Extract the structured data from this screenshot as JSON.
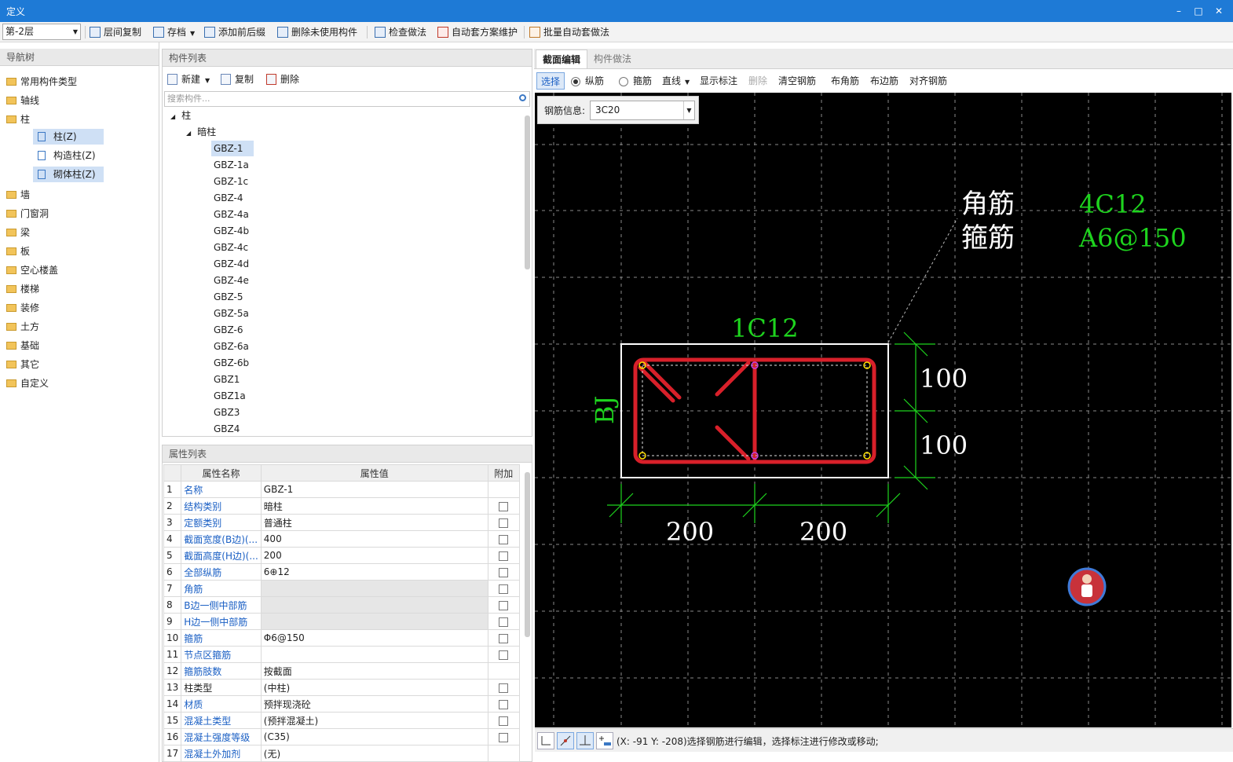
{
  "window": {
    "title": "定义"
  },
  "toolbar": {
    "floor": "第-2层",
    "buttons": [
      "层间复制",
      "存档",
      "添加前后缀",
      "删除未使用构件",
      "检查做法",
      "自动套方案维护",
      "批量自动套做法"
    ]
  },
  "nav": {
    "header": "导航树",
    "items": [
      "常用构件类型",
      "轴线",
      "柱",
      "墙",
      "门窗洞",
      "梁",
      "板",
      "空心楼盖",
      "楼梯",
      "装修",
      "土方",
      "基础",
      "其它",
      "自定义"
    ],
    "sub": [
      "柱(Z)",
      "构造柱(Z)",
      "砌体柱(Z)"
    ]
  },
  "complist": {
    "header": "构件列表",
    "tools": [
      "新建",
      "复制",
      "删除"
    ],
    "search_placeholder": "搜索构件...",
    "root": "柱",
    "group": "暗柱",
    "items": [
      "GBZ-1",
      "GBZ-1a",
      "GBZ-1c",
      "GBZ-4",
      "GBZ-4a",
      "GBZ-4b",
      "GBZ-4c",
      "GBZ-4d",
      "GBZ-4e",
      "GBZ-5",
      "GBZ-5a",
      "GBZ-6",
      "GBZ-6a",
      "GBZ-6b",
      "GBZ1",
      "GBZ1a",
      "GBZ3",
      "GBZ4"
    ]
  },
  "props": {
    "header": "属性列表",
    "columns": [
      "属性名称",
      "属性值",
      "附加"
    ],
    "rows": [
      {
        "n": "1",
        "k": "名称",
        "v": "GBZ-1",
        "chk": false,
        "gray": false,
        "link": true
      },
      {
        "n": "2",
        "k": "结构类别",
        "v": "暗柱",
        "chk": true,
        "gray": false,
        "link": true
      },
      {
        "n": "3",
        "k": "定额类别",
        "v": "普通柱",
        "chk": true,
        "gray": false,
        "link": true
      },
      {
        "n": "4",
        "k": "截面宽度(B边)(...",
        "v": "400",
        "chk": true,
        "gray": false,
        "link": true
      },
      {
        "n": "5",
        "k": "截面高度(H边)(...",
        "v": "200",
        "chk": true,
        "gray": false,
        "link": true
      },
      {
        "n": "6",
        "k": "全部纵筋",
        "v": "6⊕12",
        "chk": true,
        "gray": false,
        "link": true
      },
      {
        "n": "7",
        "k": "角筋",
        "v": "",
        "chk": true,
        "gray": true,
        "link": true
      },
      {
        "n": "8",
        "k": "B边一侧中部筋",
        "v": "",
        "chk": true,
        "gray": true,
        "link": true
      },
      {
        "n": "9",
        "k": "H边一侧中部筋",
        "v": "",
        "chk": true,
        "gray": true,
        "link": true
      },
      {
        "n": "10",
        "k": "箍筋",
        "v": "Φ6@150",
        "chk": true,
        "gray": false,
        "link": true
      },
      {
        "n": "11",
        "k": "节点区箍筋",
        "v": "",
        "chk": true,
        "gray": false,
        "link": true
      },
      {
        "n": "12",
        "k": "箍筋肢数",
        "v": "按截面",
        "chk": false,
        "gray": false,
        "link": true
      },
      {
        "n": "13",
        "k": "柱类型",
        "v": "(中柱)",
        "chk": true,
        "gray": false,
        "link": false
      },
      {
        "n": "14",
        "k": "材质",
        "v": "预拌现浇砼",
        "chk": true,
        "gray": false,
        "link": true
      },
      {
        "n": "15",
        "k": "混凝土类型",
        "v": "(预拌混凝土)",
        "chk": true,
        "gray": false,
        "link": true
      },
      {
        "n": "16",
        "k": "混凝土强度等级",
        "v": "(C35)",
        "chk": true,
        "gray": false,
        "link": true
      },
      {
        "n": "17",
        "k": "混凝土外加剂",
        "v": "(无)",
        "chk": false,
        "gray": false,
        "link": true
      }
    ]
  },
  "editor": {
    "tabs": [
      "截面编辑",
      "构件做法"
    ],
    "tools": {
      "select": "选择",
      "radio_long": "纵筋",
      "radio_stirrup": "箍筋",
      "line": "直线",
      "show_label": "显示标注",
      "delete": "删除",
      "clear": "清空钢筋",
      "corner": "布角筋",
      "edge": "布边筋",
      "align": "对齐钢筋"
    },
    "rebar_info_label": "钢筋信息:",
    "rebar_info_value": "3C20"
  },
  "drawing": {
    "corner_label": "角筋",
    "corner_value": "4C12",
    "stirrup_label": "箍筋",
    "stirrup_value": "A6@150",
    "mid_label": "1C12",
    "side_label": "BJ",
    "dim_h1": "100",
    "dim_h2": "100",
    "dim_w1": "200",
    "dim_w2": "200"
  },
  "status": {
    "text": "(X: -91 Y: -208)选择钢筋进行编辑，选择标注进行修改或移动;"
  }
}
